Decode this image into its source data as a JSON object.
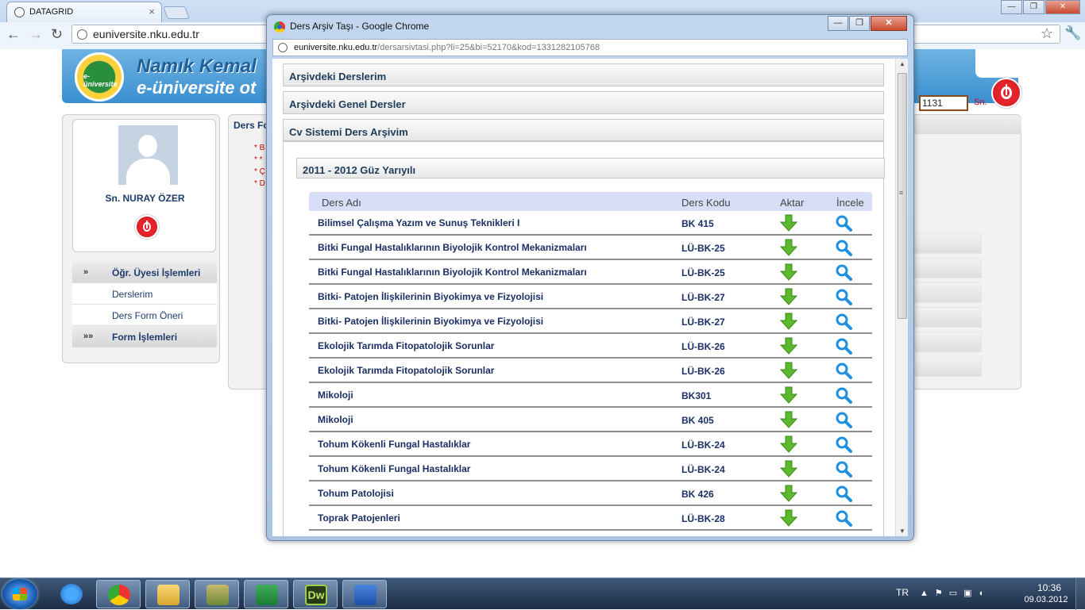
{
  "bg_browser": {
    "tab_title": "DATAGRID",
    "url": "euniversite.nku.edu.tr",
    "brand_line1": "Namık Kemal",
    "brand_line2": "e-üniversite ot",
    "logo_text": "e-üniversite",
    "code_value": "1131",
    "sn_label": "Sn.",
    "user_name": "Sn. NURAY ÖZER",
    "content_title": "Ders Fo",
    "notes": [
      "* B",
      "* *",
      "* Ç",
      "* D"
    ],
    "menu": [
      {
        "label": "Öğr. Üyesi İşlemleri",
        "type": "head",
        "icon": "»"
      },
      {
        "label": "Derslerim",
        "type": "item",
        "icon": ""
      },
      {
        "label": "Ders Form Öneri",
        "type": "item",
        "icon": ""
      },
      {
        "label": "Form İşlemleri",
        "type": "head",
        "icon": "»»"
      }
    ]
  },
  "popup": {
    "title": "Ders Arşiv Taşı - Google Chrome",
    "url_host": "euniversite.nku.edu.tr",
    "url_path": "/dersarsivtasi.php?li=25&bi=52170&kod=1331282105768",
    "sections": [
      "Arşivdeki Derslerim",
      "Arşivdeki Genel Dersler",
      "Cv Sistemi Ders Arşivim"
    ],
    "semester": "2011 - 2012 Güz Yarıyılı",
    "columns": {
      "name": "Ders Adı",
      "code": "Ders Kodu",
      "aktar": "Aktar",
      "incele": "İncele"
    },
    "rows": [
      {
        "name": "Bilimsel Çalışma Yazım ve Sunuş Teknikleri I",
        "code": "BK 415"
      },
      {
        "name": "Bitki Fungal Hastalıklarının Biyolojik Kontrol Mekanizmaları",
        "code": "LÜ-BK-25"
      },
      {
        "name": "Bitki Fungal Hastalıklarının Biyolojik Kontrol Mekanizmaları",
        "code": "LÜ-BK-25"
      },
      {
        "name": "Bitki- Patojen İlişkilerinin Biyokimya ve Fizyolojisi",
        "code": "LÜ-BK-27"
      },
      {
        "name": "Bitki- Patojen İlişkilerinin Biyokimya ve Fizyolojisi",
        "code": "LÜ-BK-27"
      },
      {
        "name": "Ekolojik Tarımda Fitopatolojik Sorunlar",
        "code": "LÜ-BK-26"
      },
      {
        "name": "Ekolojik Tarımda Fitopatolojik Sorunlar",
        "code": "LÜ-BK-26"
      },
      {
        "name": "Mikoloji",
        "code": "BK301"
      },
      {
        "name": "Mikoloji",
        "code": "BK 405"
      },
      {
        "name": "Tohum Kökenli Fungal Hastalıklar",
        "code": "LÜ-BK-24"
      },
      {
        "name": "Tohum Kökenli Fungal Hastalıklar",
        "code": "LÜ-BK-24"
      },
      {
        "name": "Tohum Patolojisi",
        "code": "BK 426"
      },
      {
        "name": "Toprak Patojenleri",
        "code": "LÜ-BK-28"
      }
    ]
  },
  "taskbar": {
    "apps": [
      "internet-explorer-icon",
      "chrome-icon",
      "explorer-icon",
      "app-icon",
      "excel-icon",
      "dreamweaver-icon",
      "word-icon"
    ],
    "lang": "TR",
    "time": "10:36",
    "date": "09.03.2012"
  },
  "colors": {
    "accent": "#1a2f63",
    "table_head": "#d8def8",
    "download_green": "#5cb82c",
    "search_blue": "#1e90e0"
  }
}
